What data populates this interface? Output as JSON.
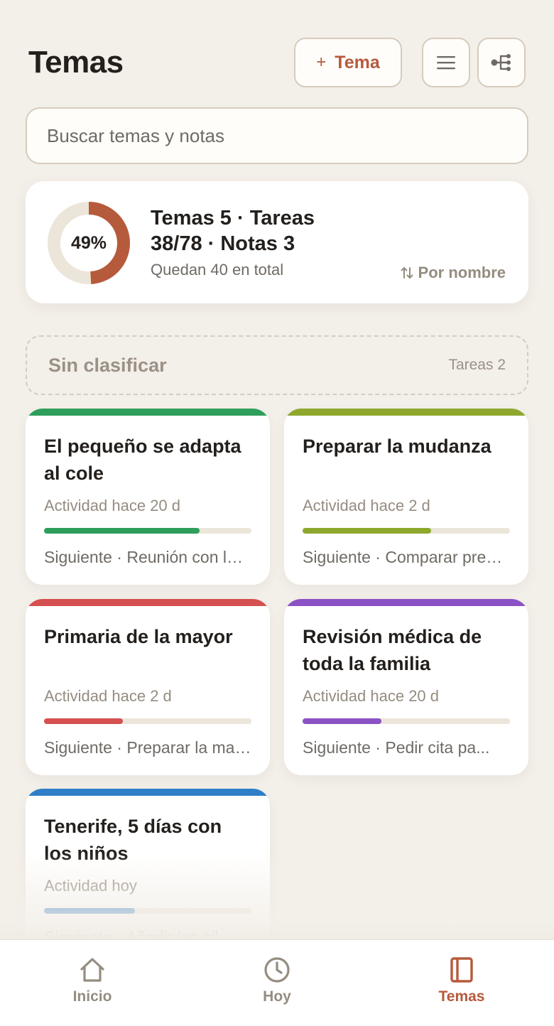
{
  "header": {
    "title": "Temas",
    "add_label": "Tema",
    "add_plus": "+"
  },
  "search": {
    "placeholder": "Buscar temas y notas"
  },
  "summary": {
    "percent": 49,
    "percent_label": "49%",
    "headline": "Temas 5 · Tareas 38/78 · Notas 3",
    "subline": "Quedan 40 en total",
    "sort_label": "Por nombre"
  },
  "unclassified": {
    "title": "Sin clasificar",
    "count": "Tareas 2"
  },
  "topics": [
    {
      "title": "El pequeño se adapta al cole",
      "activity": "Actividad hace 20 d",
      "progress": 0.75,
      "color": "#2e9e5b",
      "next": "Siguiente · Reunión con la tutora"
    },
    {
      "title": "Preparar la mudanza",
      "activity": "Actividad hace 2 d",
      "progress": 0.62,
      "color": "#8ea82e",
      "next": "Siguiente · Comparar presupuestos"
    },
    {
      "title": "Primaria de la mayor",
      "activity": "Actividad hace 2 d",
      "progress": 0.38,
      "color": "#d55050",
      "next": "Siguiente · Preparar la matrícula"
    },
    {
      "title": "Revisión médica de toda la familia",
      "activity": "Actividad hace 20 d",
      "progress": 0.38,
      "color": "#8a52c4",
      "next": "Siguiente · Pedir cita pa..."
    },
    {
      "title": "Tenerife, 5 días con los niños",
      "activity": "Actividad hoy",
      "progress": 0.44,
      "color": "#2f7ec8",
      "next": "Siguiente · Añadir las sil..."
    }
  ],
  "colors": {
    "accent": "#b65a3c",
    "ring_track": "#ece5da"
  },
  "tabs": [
    {
      "label": "Inicio",
      "icon": "home-icon",
      "active": false
    },
    {
      "label": "Hoy",
      "icon": "clock-icon",
      "active": false
    },
    {
      "label": "Temas",
      "icon": "notebook-icon",
      "active": true
    }
  ]
}
